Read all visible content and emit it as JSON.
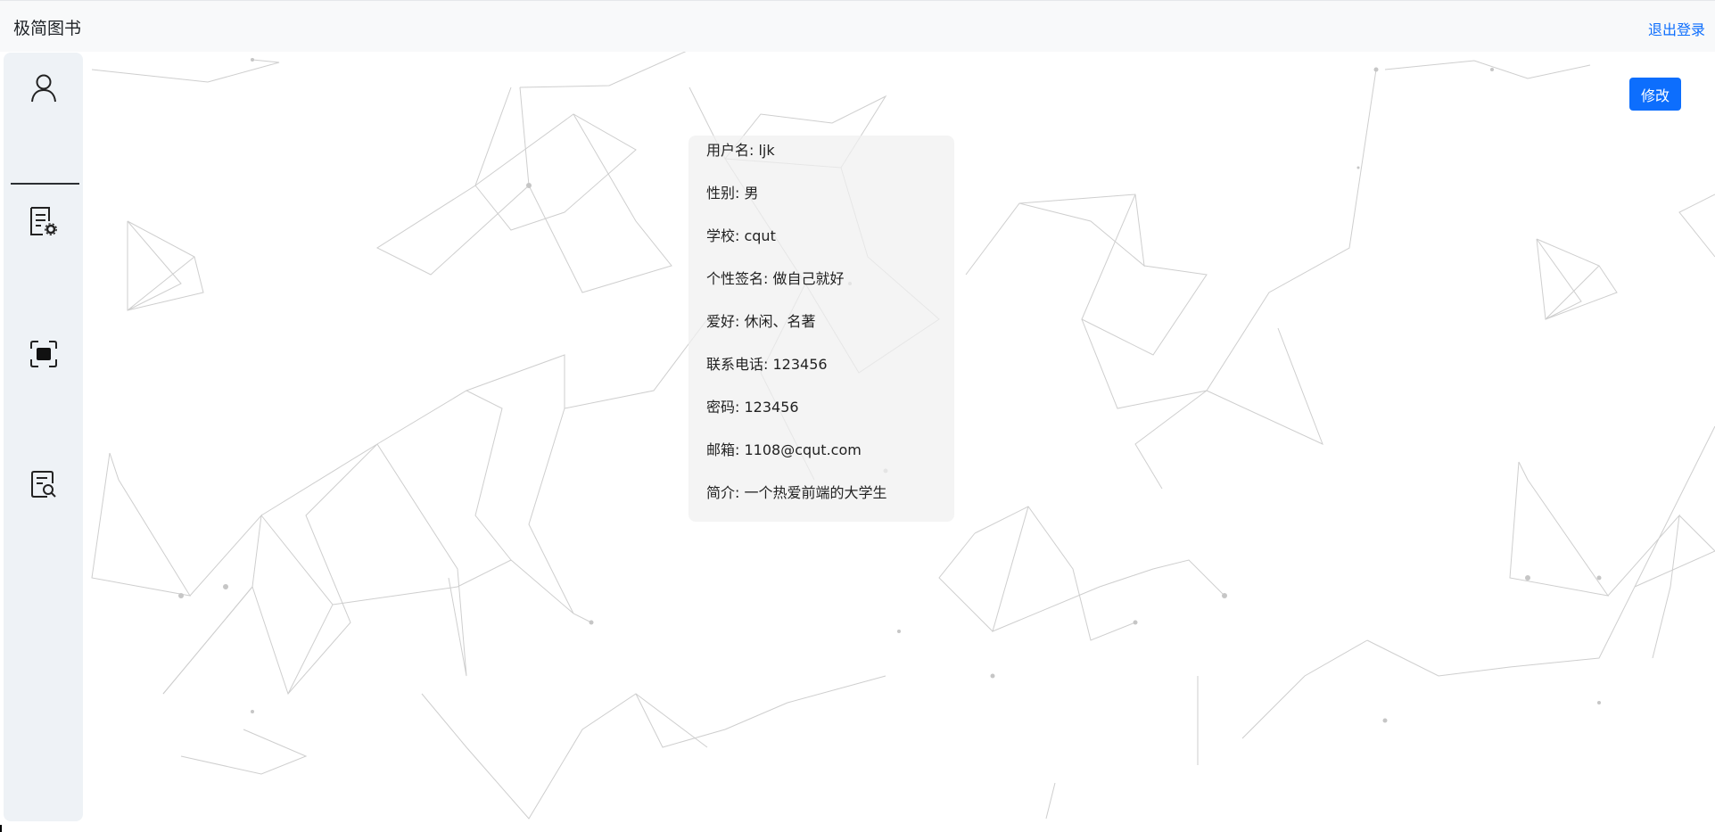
{
  "header": {
    "app_title": "极简图书",
    "logout_label": "退出登录"
  },
  "sidebar": {
    "items": [
      {
        "name": "person-icon"
      },
      {
        "name": "document-settings-icon"
      },
      {
        "name": "scan-icon"
      },
      {
        "name": "document-search-icon"
      }
    ]
  },
  "main": {
    "edit_label": "修改",
    "profile": [
      {
        "label": "用户名",
        "value": "ljk",
        "text": "用户名: ljk"
      },
      {
        "label": "性别",
        "value": "男",
        "text": "性别: 男"
      },
      {
        "label": "学校",
        "value": "cqut",
        "text": "学校: cqut"
      },
      {
        "label": "个性签名",
        "value": "做自己就好",
        "text": "个性签名: 做自己就好"
      },
      {
        "label": "爱好",
        "value": "休闲、名著",
        "text": "爱好: 休闲、名著"
      },
      {
        "label": "联系电话",
        "value": "123456",
        "text": "联系电话: 123456"
      },
      {
        "label": "密码",
        "value": "123456",
        "text": "密码: 123456"
      },
      {
        "label": "邮箱",
        "value": "1108@cqut.com",
        "text": "邮箱: 1108@cqut.com"
      },
      {
        "label": "简介",
        "value": "一个热爱前端的大学生",
        "text": "简介: 一个热爱前端的大学生"
      }
    ]
  },
  "colors": {
    "accent": "#0d6efd",
    "topbar_bg": "#f8f9fa",
    "sidebar_bg": "#eef2f6",
    "card_bg": "#f0f0f0"
  }
}
